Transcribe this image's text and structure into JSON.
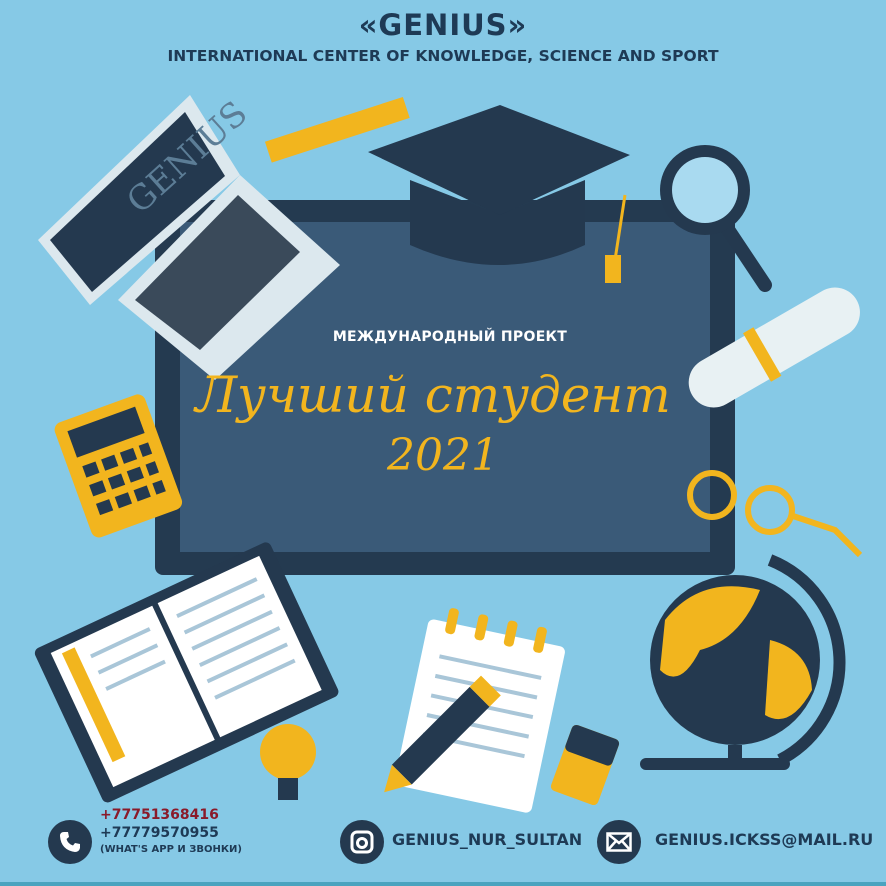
{
  "header": {
    "brand": "«GENIUS»",
    "tagline": "INTERNATIONAL CENTER OF KNOWLEDGE, SCIENCE AND SPORT"
  },
  "board": {
    "project": "МЕЖДУНАРОДНЫЙ ПРОЕКТ",
    "title_line1": "Лучший студент",
    "title_line2": "2021"
  },
  "laptop": {
    "screen_text": "GENIUS"
  },
  "contacts": {
    "phone_primary": "+77751368416",
    "phone_secondary": "+77779570955",
    "phone_note": "(WHAT'S APP И ЗВОНКИ)",
    "instagram": "GENIUS_NUR_SULTAN",
    "email": "GENIUS.ICKSS@MAIL.RU"
  },
  "icons": [
    "phone-icon",
    "instagram-icon",
    "mail-icon"
  ],
  "colors": {
    "background": "#86c9e6",
    "navy": "#24394f",
    "board": "#3a5a78",
    "accent": "#f2b51e",
    "phone_primary": "#8a1a2a"
  }
}
